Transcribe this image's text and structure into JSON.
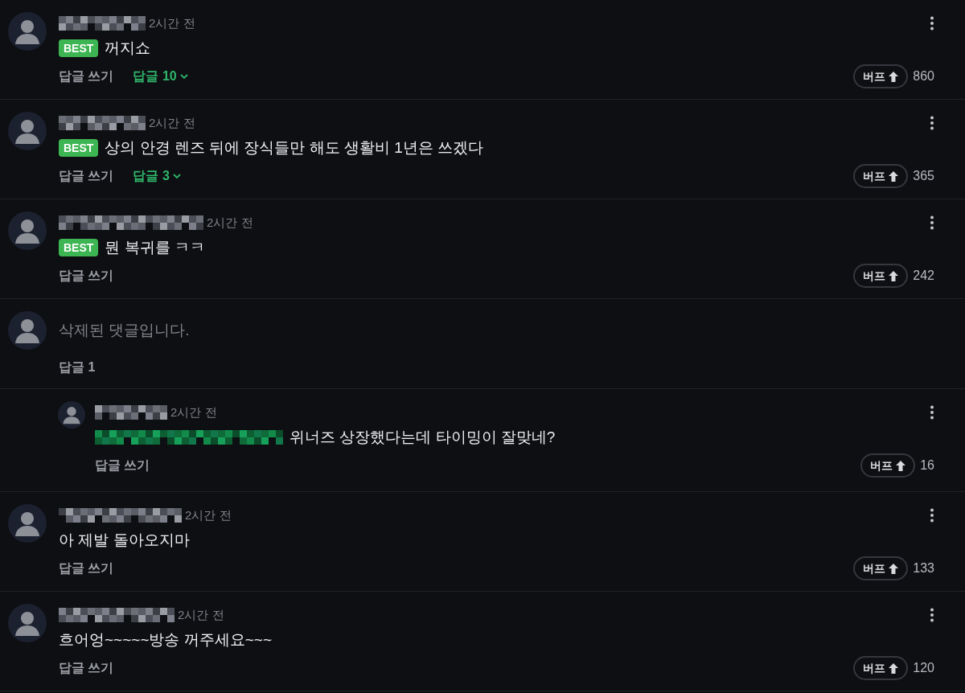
{
  "comments": [
    {
      "kind": "comment",
      "time": "2시간 전",
      "best": true,
      "best_label": "BEST",
      "text": "꺼지쇼",
      "reply_write": "답글 쓰기",
      "replies_toggle": {
        "label": "답글 10",
        "expanded": false
      },
      "buff_label": "버프",
      "count": "860"
    },
    {
      "kind": "comment",
      "time": "2시간 전",
      "best": true,
      "best_label": "BEST",
      "text": "상의 안경 렌즈 뒤에 장식들만 해도 생활비 1년은 쓰겠다",
      "reply_write": "답글 쓰기",
      "replies_toggle": {
        "label": "답글 3",
        "expanded": false
      },
      "buff_label": "버프",
      "count": "365"
    },
    {
      "kind": "comment",
      "time": "2시간 전",
      "best": true,
      "best_label": "BEST",
      "text": "뭔 복귀를 ㅋㅋ",
      "reply_write": "답글 쓰기",
      "buff_label": "버프",
      "count": "242"
    },
    {
      "kind": "deleted",
      "text": "삭제된 댓글입니다.",
      "replies_label": "답글 1",
      "children": [
        {
          "kind": "reply",
          "time": "2시간 전",
          "mention": true,
          "text": "위너즈 상장했다는데 타이밍이 잘맞네?",
          "reply_write": "답글 쓰기",
          "buff_label": "버프",
          "count": "16"
        }
      ]
    },
    {
      "kind": "comment",
      "time": "2시간 전",
      "best": false,
      "text": "아 제발 돌아오지마",
      "reply_write": "답글 쓰기",
      "buff_label": "버프",
      "count": "133"
    },
    {
      "kind": "comment",
      "time": "2시간 전",
      "best": false,
      "text": "흐어엉~~~~~방송 꺼주세요~~~",
      "reply_write": "답글 쓰기",
      "buff_label": "버프",
      "count": "120"
    }
  ]
}
